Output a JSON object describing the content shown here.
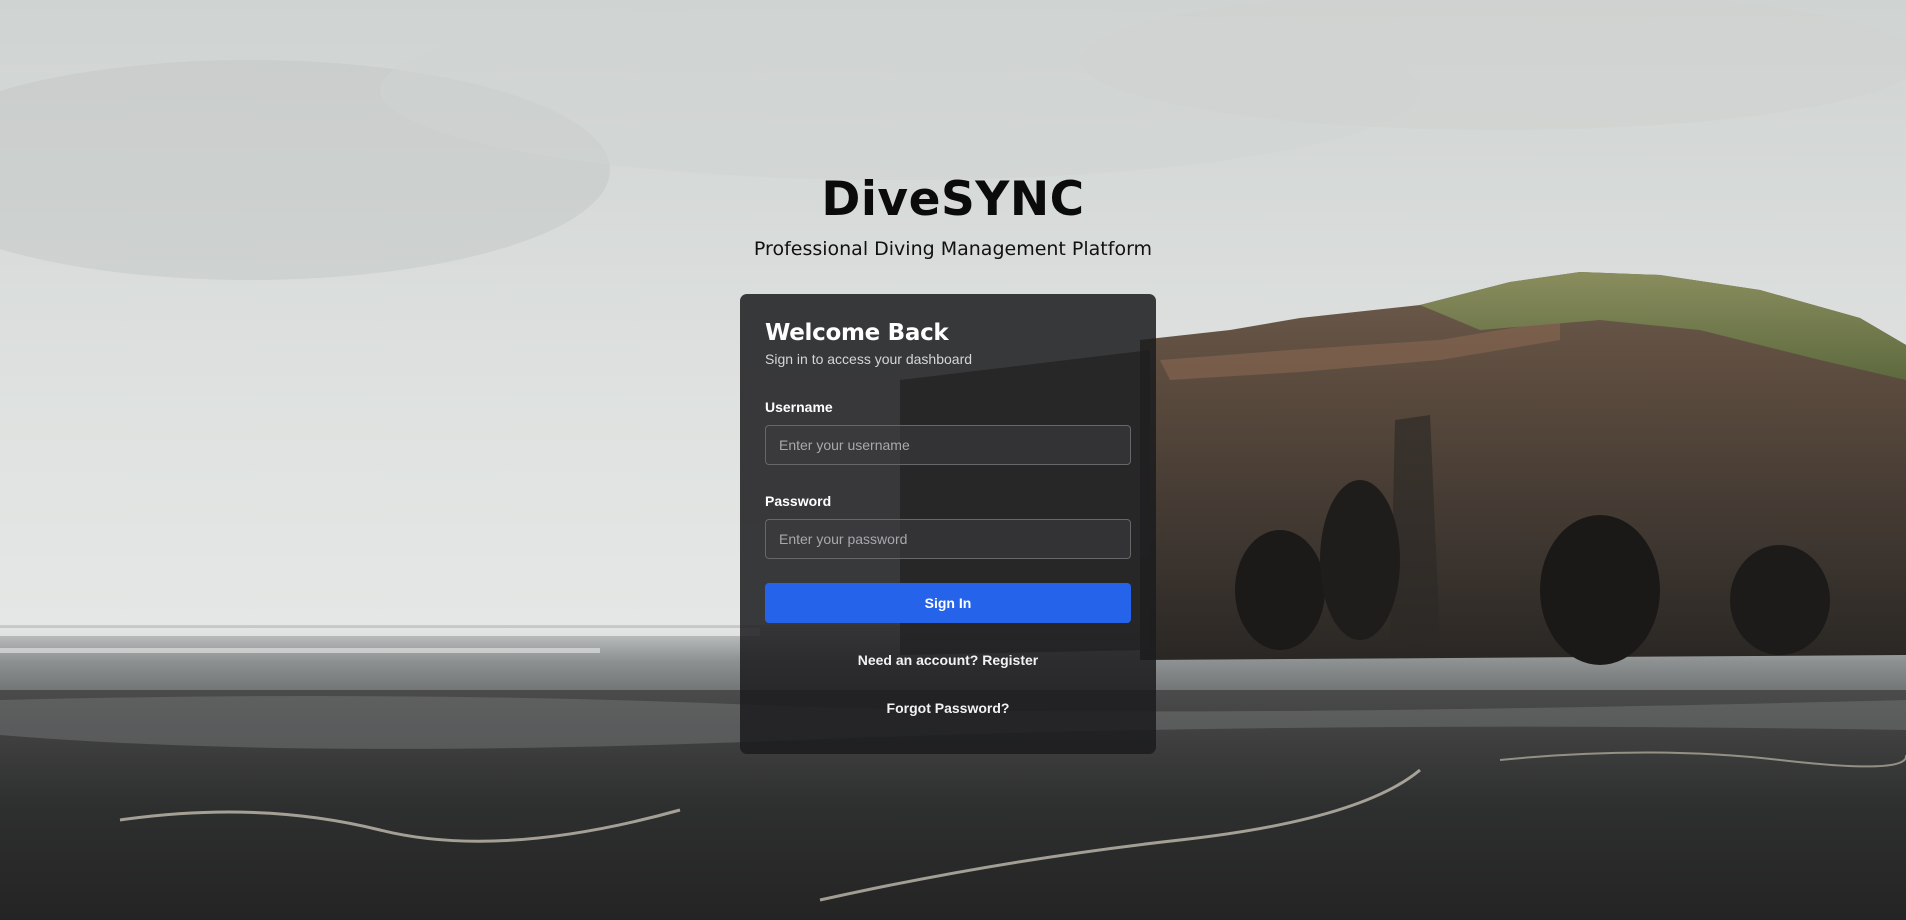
{
  "brand": {
    "title": "DiveSYNC",
    "subtitle": "Professional Diving Management Platform"
  },
  "login": {
    "title": "Welcome Back",
    "subtitle": "Sign in to access your dashboard",
    "username_label": "Username",
    "username_placeholder": "Enter your username",
    "username_value": "",
    "password_label": "Password",
    "password_placeholder": "Enter your password",
    "password_value": "",
    "submit_label": "Sign In",
    "register_link": "Need an account? Register",
    "forgot_link": "Forgot Password?"
  },
  "colors": {
    "accent": "#2563eb",
    "card_background": "#1c1c1e",
    "text_dark": "#0b0b0b"
  }
}
